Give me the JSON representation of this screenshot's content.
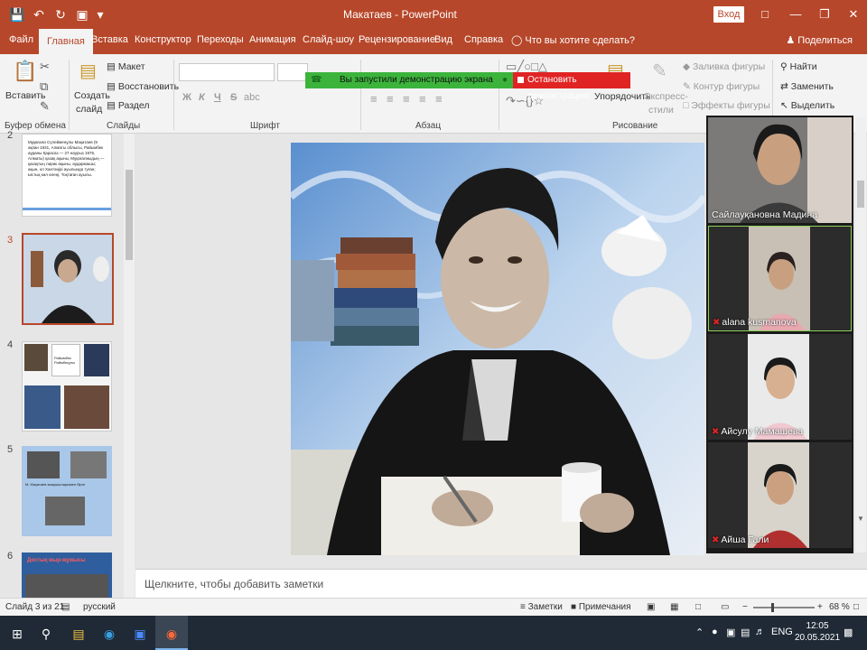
{
  "window": {
    "title": "Макатаев - PowerPoint",
    "signin": "Вход"
  },
  "tabs": [
    "Файл",
    "Главная",
    "Вставка",
    "Конструктор",
    "Переходы",
    "Анимация",
    "Слайд-шоу",
    "Рецензирование",
    "Вид",
    "Справка"
  ],
  "tell_me": "Что вы хотите сделать?",
  "share_label": "Поделиться",
  "ribbon": {
    "paste": "Вставить",
    "clipboard_group": "Буфер обмена",
    "new_slide_1": "Создать",
    "new_slide_2": "слайд",
    "layout": "Макет",
    "reset": "Восстановить",
    "section": "Раздел",
    "slides_group": "Слайды",
    "font_group": "Шрифт",
    "paragraph_group": "Абзац",
    "arrange": "Упорядочить",
    "quick_styles_1": "Экспресс-",
    "quick_styles_2": "стили",
    "shape_fill": "Заливка фигуры",
    "shape_outline": "Контур фигуры",
    "shape_effects": "Эффекты фигуры",
    "drawing_group": "Рисование",
    "find": "Найти",
    "replace": "Заменить",
    "select": "Выделить",
    "bold": "Ж",
    "italic": "К",
    "underline": "Ч",
    "strike": "S",
    "shadow": "abc"
  },
  "screen_share": {
    "status": "Вы запустили демонстрацию экрана",
    "stop": "Остановить демонстрацию"
  },
  "thumbnails": [
    {
      "number": "2",
      "text": "Мұқағали Сүлейменұлы Мақатаев (9 ақпан 1931, Алматы облысы, Райымбек ауданы Қарасаз — 27 наурыз 1976, Алматы) қазақ ақыны, Мұқағалиыдың — қазақтың лирик ақыны, аудармашы; ақын, ол Хантәңірі ауылында туған; Ыстық көл өлеңі, Тоқтаған ауылы."
    },
    {
      "number": "3",
      "text": ""
    },
    {
      "number": "4",
      "text": "Райымбек Раймбекұлы"
    },
    {
      "number": "5",
      "text": "М. Мақатаев жазушыларымен бірге"
    },
    {
      "number": "6",
      "text": "Достық жыр-жұмысы"
    }
  ],
  "notes_placeholder": "Щелкните, чтобы добавить заметки",
  "participants": [
    {
      "name": "Сайлауқановна Мадина",
      "muted": false
    },
    {
      "name": "alana kusmanova",
      "muted": true
    },
    {
      "name": "Айсулу Мамашева",
      "muted": true
    },
    {
      "name": "Айша Гали",
      "muted": true
    }
  ],
  "status": {
    "slide": "Слайд 3 из 21",
    "language": "русский",
    "notes": "Заметки",
    "comments": "Примечания",
    "zoom": "68 %"
  },
  "taskbar": {
    "time": "12:05",
    "date": "20.05.2021",
    "lang": "ENG"
  },
  "colors": {
    "accent": "#b7472a",
    "share_green": "#3cb43c",
    "stop_red": "#e02424"
  }
}
